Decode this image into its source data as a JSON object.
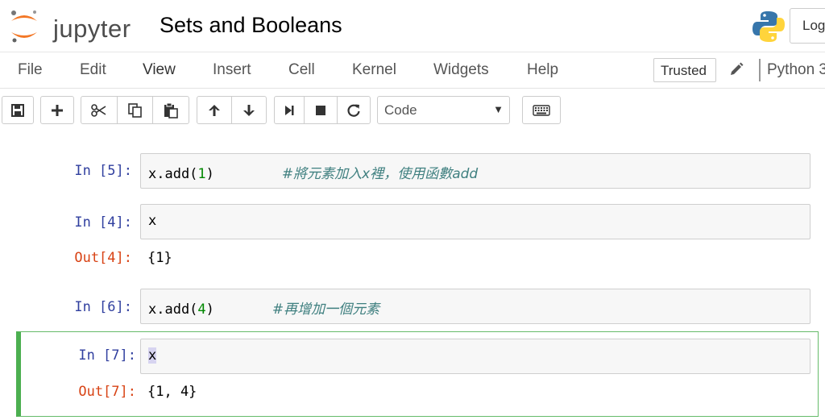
{
  "header": {
    "logo_text": "jupyter",
    "notebook_title": "Sets and Booleans",
    "login_label": "Log"
  },
  "menubar": {
    "items": [
      "File",
      "Edit",
      "View",
      "Insert",
      "Cell",
      "Kernel",
      "Widgets",
      "Help"
    ],
    "trusted_label": "Trusted",
    "kernel_name": "Python 3"
  },
  "toolbar": {
    "buttons": [
      "save-icon",
      "plus-icon",
      "scissors-icon",
      "copy-icon",
      "paste-icon",
      "arrow-up-icon",
      "arrow-down-icon",
      "step-forward-icon",
      "stop-icon",
      "restart-icon",
      "keyboard-icon"
    ],
    "cell_type": "Code"
  },
  "cells": [
    {
      "prompt": "In [5]:",
      "code": "x.add(",
      "code_num": "1",
      "code_close": ")",
      "comment": "#將元素加入x裡，使用函數add"
    },
    {
      "prompt": "In [4]:",
      "code": "x",
      "out_prompt": "Out[4]:",
      "output": "{1}"
    },
    {
      "prompt": "In [6]:",
      "code": "x.add(",
      "code_num": "4",
      "code_close": ")",
      "comment": "#再增加一個元素"
    },
    {
      "prompt": "In [7]:",
      "code": "x",
      "out_prompt": "Out[7]:",
      "output": "{1, 4}"
    }
  ],
  "colors": {
    "in_prompt": "#303f9f",
    "out_prompt": "#d84315",
    "number": "#008800",
    "comment": "#408080",
    "selected_border": "#4caf50"
  }
}
